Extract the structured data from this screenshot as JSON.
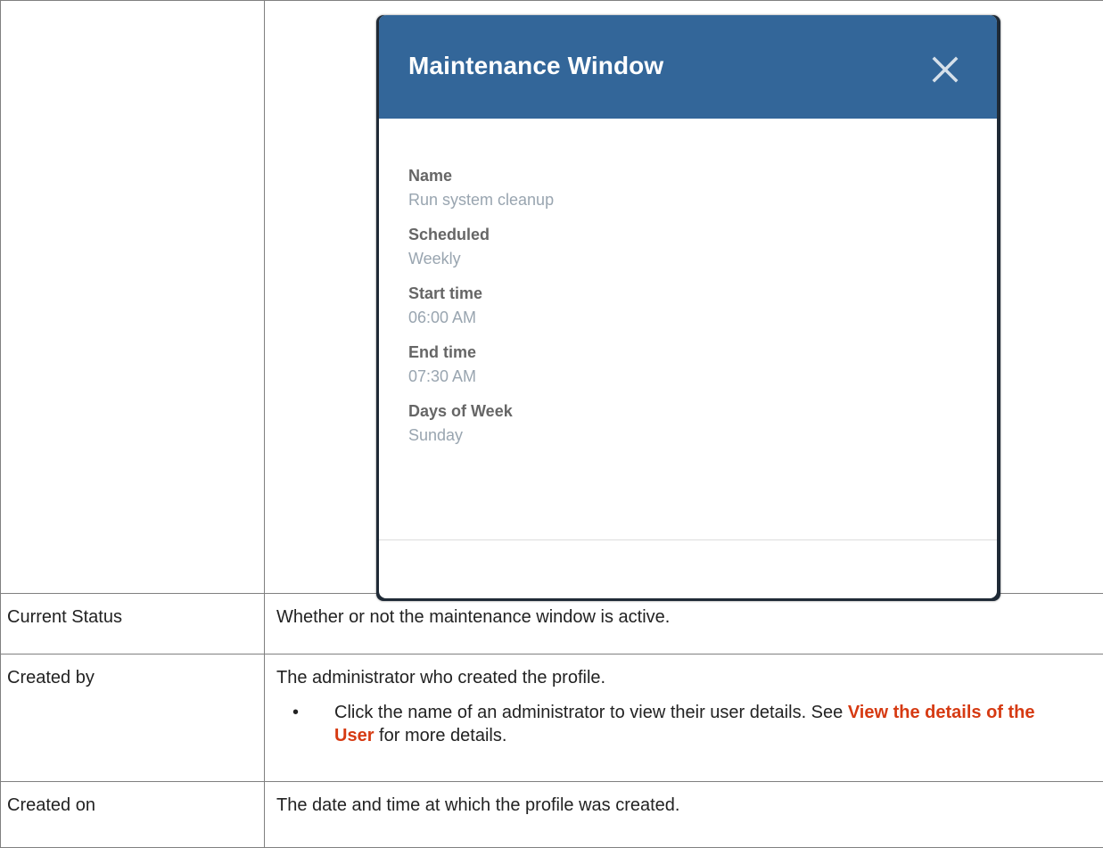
{
  "dialog": {
    "title": "Maintenance Window",
    "header_color": "#336699",
    "fields": [
      {
        "label": "Name",
        "value": "Run system cleanup"
      },
      {
        "label": "Scheduled",
        "value": "Weekly"
      },
      {
        "label": "Start time",
        "value": "06:00 AM"
      },
      {
        "label": "End time",
        "value": "07:30 AM"
      },
      {
        "label": "Days of Week",
        "value": "Sunday"
      }
    ],
    "close_icon": "close-icon"
  },
  "rows": [
    {
      "label": "Current Status",
      "description": "Whether or not the maintenance window is active."
    },
    {
      "label": "Created by",
      "description": "The administrator who created the profile.",
      "bullet": {
        "text_before": "Click the name of an administrator to view their user details. See ",
        "link": "View the details of the User",
        "text_after": " for more details."
      }
    },
    {
      "label": "Created on",
      "description": "The date and time at which the profile was created."
    }
  ],
  "colors": {
    "link": "#d63a12",
    "border": "#808080"
  }
}
